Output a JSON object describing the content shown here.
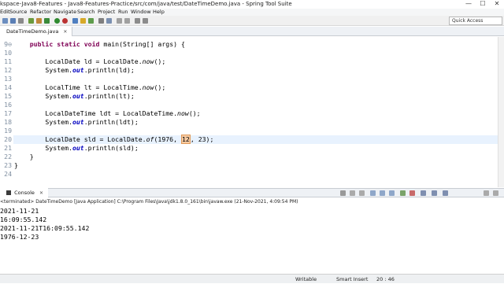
{
  "window": {
    "title": "kspace-Java8-Features - Java8-Features-Practice/src/com/java/test/DateTimeDemo.java - Spring Tool Suite",
    "minimize": "—",
    "maximize": "☐",
    "close": "✕"
  },
  "menu": [
    "Edit",
    "Source",
    "Refactor",
    "Navigate",
    "Search",
    "Project",
    "Run",
    "Window",
    "Help"
  ],
  "toolbar": {
    "quick_access": "Quick Access"
  },
  "editor": {
    "tab_label": "DateTimeDemo.java",
    "tab_close": "✕",
    "lines": [
      {
        "n": "9⊖",
        "code": "    public static void main(String[] args) {"
      },
      {
        "n": "10",
        "code": ""
      },
      {
        "n": "11",
        "code": "        LocalDate ld = LocalDate.now();"
      },
      {
        "n": "12",
        "code": "        System.out.println(ld);"
      },
      {
        "n": "13",
        "code": ""
      },
      {
        "n": "14",
        "code": "        LocalTime lt = LocalTime.now();"
      },
      {
        "n": "15",
        "code": "        System.out.println(lt);"
      },
      {
        "n": "16",
        "code": ""
      },
      {
        "n": "17",
        "code": "        LocalDateTime ldt = LocalDateTime.now();"
      },
      {
        "n": "18",
        "code": "        System.out.println(ldt);"
      },
      {
        "n": "19",
        "code": ""
      },
      {
        "n": "20",
        "code": "        LocalDate sld = LocalDate.of(1976, 12, 23);"
      },
      {
        "n": "21",
        "code": "        System.out.println(sld);"
      },
      {
        "n": "22",
        "code": "    }"
      },
      {
        "n": "23",
        "code": "}"
      },
      {
        "n": "24",
        "code": ""
      }
    ]
  },
  "console": {
    "tab_label": "Console",
    "tab_close": "✕",
    "terminated": "<terminated> DateTimeDemo [Java Application] C:\\Program Files\\Java\\jdk1.8.0_161\\bin\\javaw.exe (21-Nov-2021, 4:09:54 PM)",
    "output": [
      "2021-11-21",
      "16:09:55.142",
      "2021-11-21T16:09:55.142",
      "1976-12-23"
    ]
  },
  "status": {
    "writable": "Writable",
    "insert_mode": "Smart Insert",
    "position": "20 : 46"
  }
}
